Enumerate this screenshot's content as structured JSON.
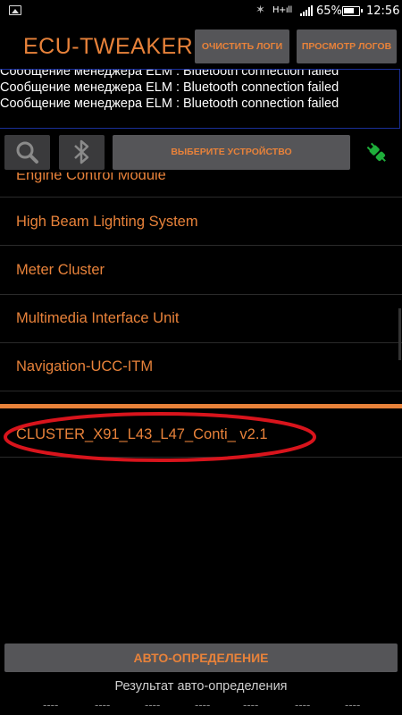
{
  "status_bar": {
    "network": "H+ıll",
    "battery_percent": "65%",
    "time": "12:56",
    "icons": [
      "image-icon",
      "bluetooth-icon",
      "signal-icon",
      "battery-icon"
    ]
  },
  "header": {
    "title": "ECU-TWEAKER",
    "clear_logs_label": "ОЧИСТИТЬ ЛОГИ",
    "view_logs_label": "ПРОСМОТР ЛОГОВ"
  },
  "log": {
    "lines": [
      "Сообщение менеджера ELM : Bluetooth connection failed",
      "Сообщение менеджера ELM : Bluetooth connection failed",
      "Сообщение менеджера ELM : Bluetooth connection failed"
    ]
  },
  "toolbar": {
    "select_device_label": "ВЫБЕРИТЕ УСТРОЙСТВО",
    "icons": [
      "search-icon",
      "bluetooth-icon",
      "plug-icon"
    ]
  },
  "ecu_list": {
    "items": [
      "Engine Control Module",
      "High Beam Lighting System",
      "Meter Cluster",
      "Multimedia Interface Unit",
      "Navigation-UCC-ITM"
    ]
  },
  "selected_file": {
    "label": "CLUSTER_X91_L43_L47_Conti_ v2.1"
  },
  "bottom": {
    "auto_detect_label": "АВТО-ОПРЕДЕЛЕНИЕ",
    "auto_result_label": "Результат авто-определения",
    "results": [
      "----",
      "----",
      "----",
      "----",
      "----",
      "----",
      "----"
    ]
  },
  "colors": {
    "accent": "#e8823a",
    "button_bg": "#555558",
    "log_border": "#1a2f9a",
    "highlight_ellipse": "#d8141c"
  }
}
